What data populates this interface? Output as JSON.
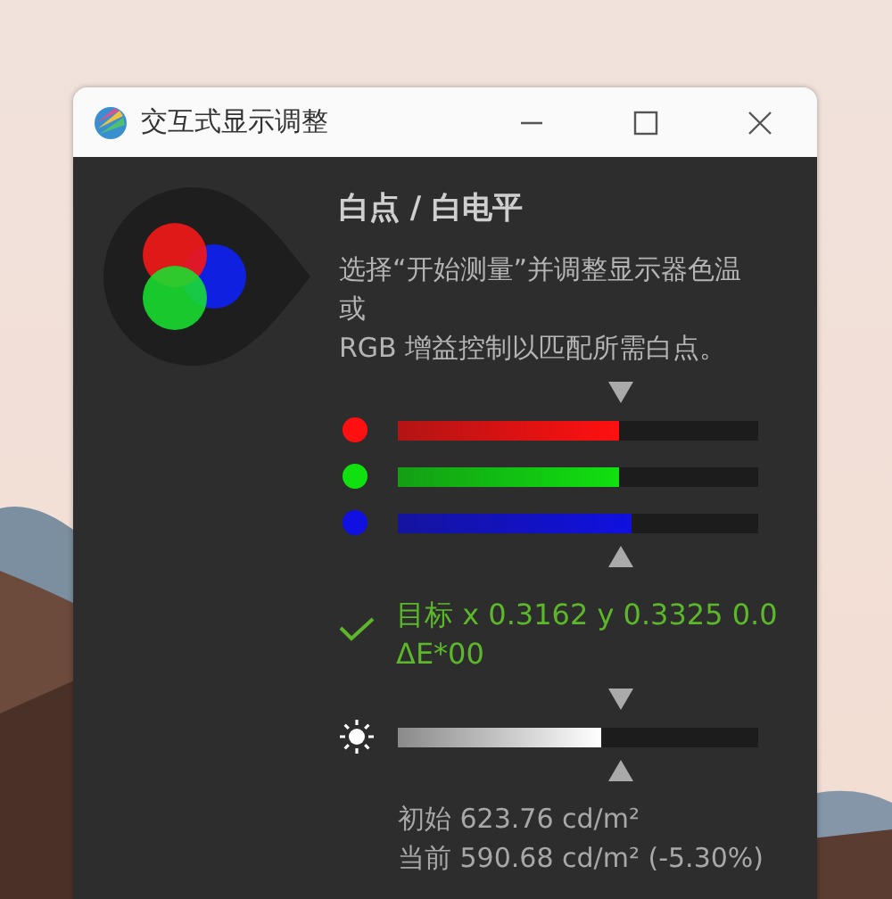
{
  "window": {
    "title": "交互式显示调整"
  },
  "heading": "白点 / 白电平",
  "description": "选择“开始测量”并调整显示器色温或\nRGB 增益控制以匹配所需白点。",
  "channels": [
    {
      "color": "#ff1010",
      "level": 0.615
    },
    {
      "color": "#10e010",
      "level": 0.615
    },
    {
      "color": "#1010e0",
      "level": 0.65
    }
  ],
  "target": {
    "ok": true,
    "text": "目标 x 0.3162 y 0.3325 0.0 ΔE*00"
  },
  "brightness": {
    "level": 0.565
  },
  "readings": [
    "初始 623.76 cd/m²",
    "当前 590.68 cd/m² (-5.30%)"
  ]
}
